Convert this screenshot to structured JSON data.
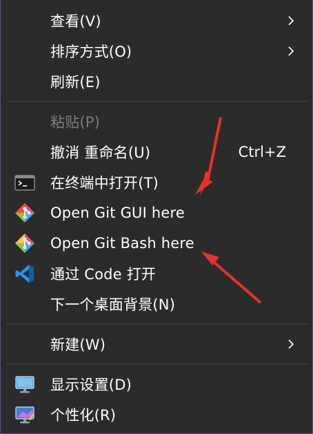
{
  "menu": {
    "items": [
      {
        "label": "查看(V)"
      },
      {
        "label": "排序方式(O)"
      },
      {
        "label": "刷新(E)"
      },
      {
        "label": "粘贴(P)"
      },
      {
        "label": "撤消 重命名(U)",
        "shortcut": "Ctrl+Z"
      },
      {
        "label": "在终端中打开(T)",
        "icon": "terminal-icon"
      },
      {
        "label": "Open Git GUI here",
        "icon": "git-gui-icon"
      },
      {
        "label": "Open Git Bash here",
        "icon": "git-bash-icon"
      },
      {
        "label": "通过 Code 打开",
        "icon": "vscode-icon"
      },
      {
        "label": "下一个桌面背景(N)"
      },
      {
        "label": "新建(W)"
      },
      {
        "label": "显示设置(D)",
        "icon": "display-settings-icon"
      },
      {
        "label": "个性化(R)",
        "icon": "personalization-icon"
      }
    ]
  },
  "colors": {
    "menu_bg": "#2b2b2b",
    "text": "#ffffff",
    "disabled_text": "#7c7c7c",
    "separator": "#454545",
    "frame_accent": "#6b4e92",
    "arrow_red": "#e8312a"
  }
}
